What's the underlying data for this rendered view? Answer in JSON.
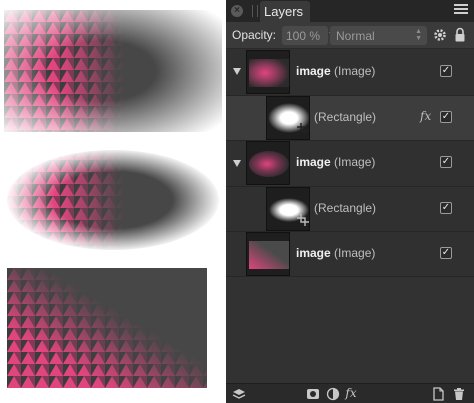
{
  "panel": {
    "tab_title": "Layers",
    "close_glyph": "×",
    "opacity_label": "Opacity:",
    "opacity_value": "100 %",
    "blend_mode": "Normal",
    "layers": [
      {
        "name": "image",
        "type": "(Image)",
        "checked": "✓",
        "expanded": true
      },
      {
        "name": "(Rectangle)",
        "type": "",
        "checked": "✓",
        "fx": "fx"
      },
      {
        "name": "image",
        "type": "(Image)",
        "checked": "✓",
        "expanded": true
      },
      {
        "name": "(Rectangle)",
        "type": "",
        "checked": "✓"
      },
      {
        "name": "image",
        "type": "(Image)",
        "checked": "✓"
      }
    ],
    "bottom_fx": "fx"
  },
  "colors": {
    "panel_bg": "#323232",
    "tab_bg": "#262626",
    "pink": "#e0457e",
    "dark": "#3a3a3a"
  },
  "icons": [
    "close-icon",
    "panel-menu-icon",
    "gear-icon",
    "lock-icon",
    "disclosure-triangle-icon",
    "checkbox-icon",
    "fx-icon",
    "layers-stack-icon",
    "mask-icon",
    "adjustment-icon",
    "new-layer-icon",
    "trash-icon",
    "crop-mask-icon"
  ]
}
